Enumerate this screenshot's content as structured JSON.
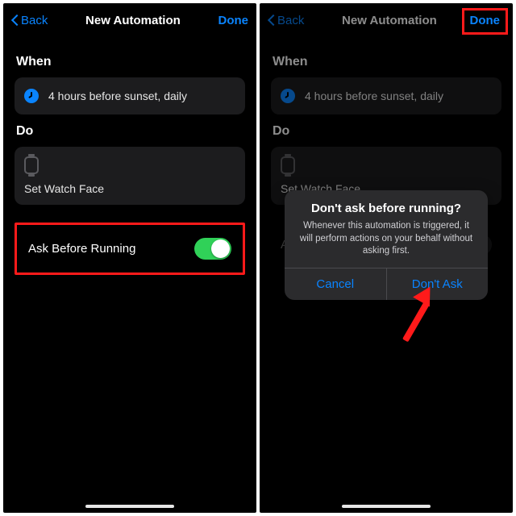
{
  "colors": {
    "accent": "#0a84ff",
    "toggle_on": "#30d158",
    "highlight": "#ff1a1a"
  },
  "nav": {
    "back": "Back",
    "title": "New Automation",
    "done": "Done"
  },
  "sections": {
    "when": "When",
    "do": "Do"
  },
  "when_card": {
    "icon": "clock-icon",
    "text": "4 hours before sunset, daily"
  },
  "do_card": {
    "icon": "watch-icon",
    "text": "Set Watch Face"
  },
  "ask_row": {
    "label": "Ask Before Running"
  },
  "left": {
    "toggle_on": true
  },
  "right": {
    "toggle_on": false
  },
  "alert": {
    "title": "Don't ask before running?",
    "message": "Whenever this automation is triggered, it will perform actions on your behalf without asking first.",
    "cancel": "Cancel",
    "confirm": "Don't Ask"
  }
}
